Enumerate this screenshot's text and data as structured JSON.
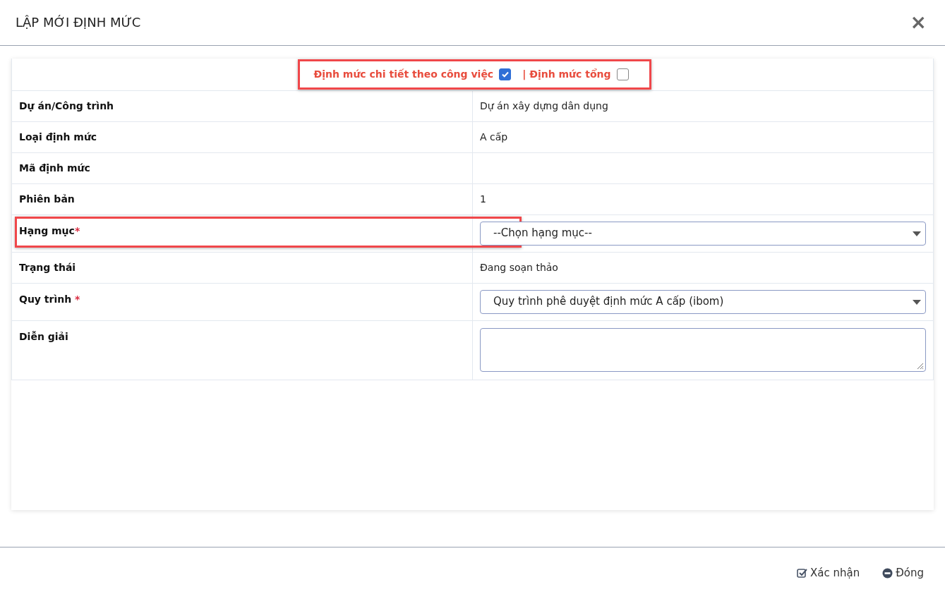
{
  "dialog": {
    "title": "LẬP MỚI ĐỊNH MỨC",
    "close_label": "×"
  },
  "mode_options": [
    {
      "label": "Định mức chi tiết theo công việc",
      "checked": true
    },
    {
      "label": "Định mức tổng",
      "prefix": "|",
      "checked": false
    }
  ],
  "fields": [
    {
      "label": "Dự án/Công trình",
      "kind": "text",
      "value": "Dự án xây dựng dân dụng"
    },
    {
      "label": "Loại định mức",
      "kind": "text",
      "value": "A cấp"
    },
    {
      "label": "Mã định mức",
      "kind": "text"
    },
    {
      "label": "Phiên bản",
      "kind": "text",
      "value": "1"
    },
    {
      "label": "Hạng mục",
      "required_mark": "*",
      "kind": "select",
      "value": "--Chọn hạng mục--",
      "highlighted": true
    },
    {
      "label": "Trạng thái",
      "kind": "text",
      "value": "Đang soạn thảo"
    },
    {
      "label": "Quy trình",
      "required_mark": " *",
      "kind": "select",
      "value": "Quy trình phê duyệt định mức A cấp (ibom)"
    },
    {
      "label": "Diễn giải",
      "kind": "textarea"
    }
  ],
  "footer_buttons": [
    {
      "label": "Xác nhận",
      "kind": "confirm"
    },
    {
      "label": "Đóng",
      "kind": "close"
    }
  ]
}
